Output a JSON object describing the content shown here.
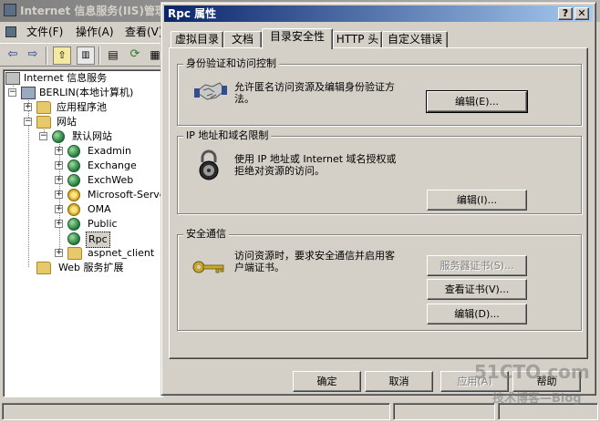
{
  "mmc": {
    "title": "Internet 信息服务(IIS)管理器",
    "menu": [
      "文件(F)",
      "操作(A)",
      "查看(V)"
    ],
    "tree": {
      "root": "Internet 信息服务",
      "server": "BERLIN(本地计算机)",
      "app_pools": "应用程序池",
      "websites": "网站",
      "default_site": "默认网站",
      "children": [
        "Exadmin",
        "Exchange",
        "ExchWeb",
        "Microsoft-Server",
        "OMA",
        "Public",
        "Rpc",
        "aspnet_client"
      ],
      "web_ext": "Web 服务扩展"
    }
  },
  "dialog": {
    "title": "Rpc 属性",
    "tabs": [
      "虚拟目录",
      "文档",
      "目录安全性",
      "HTTP 头",
      "自定义错误"
    ],
    "active_tab": "目录安全性",
    "auth": {
      "title": "身份验证和访问控制",
      "desc_line1": "允许匿名访问资源及编辑身份验证方",
      "desc_line2": "法。",
      "edit": "编辑(E)..."
    },
    "ip": {
      "title": "IP 地址和域名限制",
      "desc_line1": "使用 IP 地址或 Internet 域名授权或",
      "desc_line2": "拒绝对资源的访问。",
      "edit": "编辑(I)..."
    },
    "secure": {
      "title": "安全通信",
      "desc_line1": "访问资源时，要求安全通信并启用客",
      "desc_line2": "户端证书。",
      "server_cert": "服务器证书(S)...",
      "view_cert": "查看证书(V)...",
      "edit": "编辑(D)..."
    },
    "buttons": {
      "ok": "确定",
      "cancel": "取消",
      "apply": "应用(A)",
      "help": "帮助"
    }
  },
  "watermark": {
    "site": "51CTO.com",
    "blog": "技术博客—Blog"
  }
}
